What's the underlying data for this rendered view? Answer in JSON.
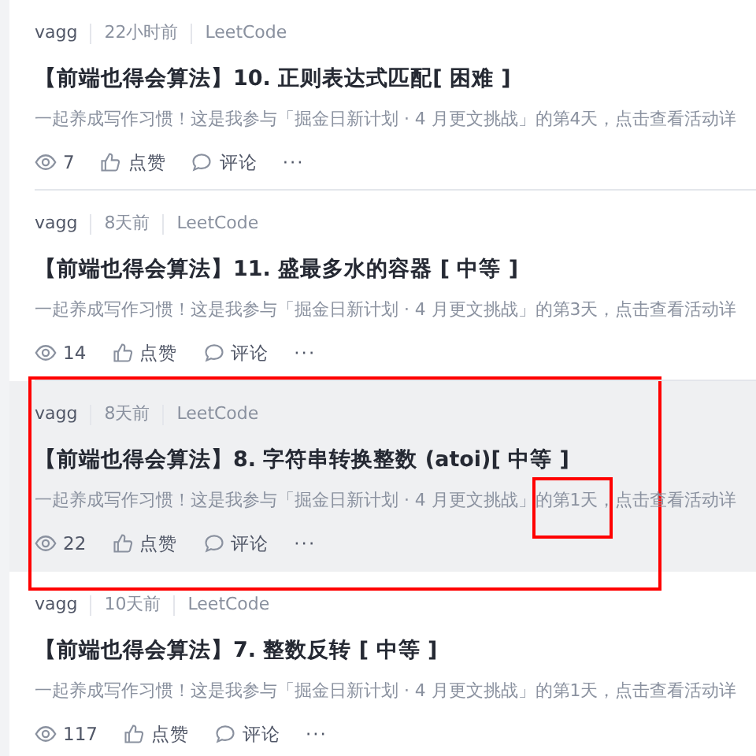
{
  "articles": [
    {
      "author": "vagg",
      "time": "22小时前",
      "tag": "LeetCode",
      "title": "【前端也得会算法】10. 正则表达式匹配[ 困难 ]",
      "excerpt": [
        {
          "text": "一起养成写作习惯！这是我参与「掘金日新计划 · 4 月更文挑战」的第4天，点击查看活动详",
          "boxed": false
        }
      ],
      "views": "7",
      "like": "点赞",
      "comment": "评论",
      "more": "···",
      "hovered": false,
      "annotated": false
    },
    {
      "author": "vagg",
      "time": "8天前",
      "tag": "LeetCode",
      "title": "【前端也得会算法】11. 盛最多水的容器 [ 中等 ]",
      "excerpt": [
        {
          "text": "一起养成写作习惯！这是我参与「掘金日新计划 · 4 月更文挑战」的第3天，点击查看活动详",
          "boxed": false
        }
      ],
      "views": "14",
      "like": "点赞",
      "comment": "评论",
      "more": "···",
      "hovered": false,
      "annotated": false
    },
    {
      "author": "vagg",
      "time": "8天前",
      "tag": "LeetCode",
      "title": "【前端也得会算法】8. 字符串转换整数 (atoi)[ 中等 ]",
      "excerpt": [
        {
          "text": "一起养成写作习惯！这是我参与「掘金日新计划 · 4 月更文挑战」",
          "boxed": false
        },
        {
          "text": "的第1天，",
          "boxed": true
        },
        {
          "text": "点击查看活动详",
          "boxed": false
        }
      ],
      "views": "22",
      "like": "点赞",
      "comment": "评论",
      "more": "···",
      "hovered": true,
      "annotated": true
    },
    {
      "author": "vagg",
      "time": "10天前",
      "tag": "LeetCode",
      "title": "【前端也得会算法】7. 整数反转 [ 中等 ]",
      "excerpt": [
        {
          "text": "一起养成写作习惯！这是我参与「掘金日新计划 · 4 月更文挑战」的第1天，点击查看活动详",
          "boxed": false
        }
      ],
      "views": "117",
      "like": "点赞",
      "comment": "评论",
      "more": "···",
      "hovered": false,
      "annotated": false
    }
  ]
}
